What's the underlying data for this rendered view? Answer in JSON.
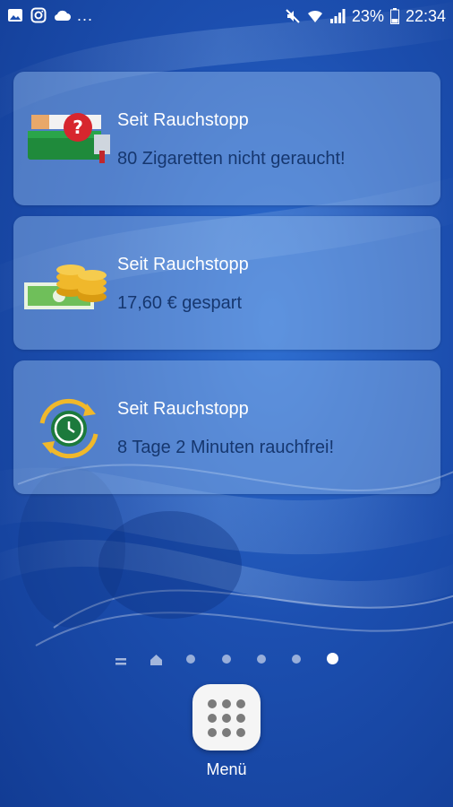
{
  "status_bar": {
    "battery_percent": "23%",
    "time": "22:34",
    "more_indicator": "...",
    "icons_left": [
      "image-icon",
      "instagram-icon",
      "cloud-icon"
    ],
    "icons_right": [
      "mute-icon",
      "wifi-icon",
      "signal-icon",
      "battery-icon"
    ]
  },
  "widgets": [
    {
      "title": "Seit Rauchstopp",
      "value": "80 Zigaretten nicht geraucht!",
      "icon": "cigarette-pack-icon"
    },
    {
      "title": "Seit Rauchstopp",
      "value": "17,60 € gespart",
      "icon": "coins-money-icon"
    },
    {
      "title": "Seit Rauchstopp",
      "value": "8 Tage 2 Minuten  rauchfrei!",
      "icon": "clock-cycle-icon"
    }
  ],
  "home": {
    "page_count": 7,
    "active_page": 7,
    "menu_label": "Menü"
  },
  "colors": {
    "card_value": "#16376f",
    "wallpaper": "#1c4fb0"
  }
}
